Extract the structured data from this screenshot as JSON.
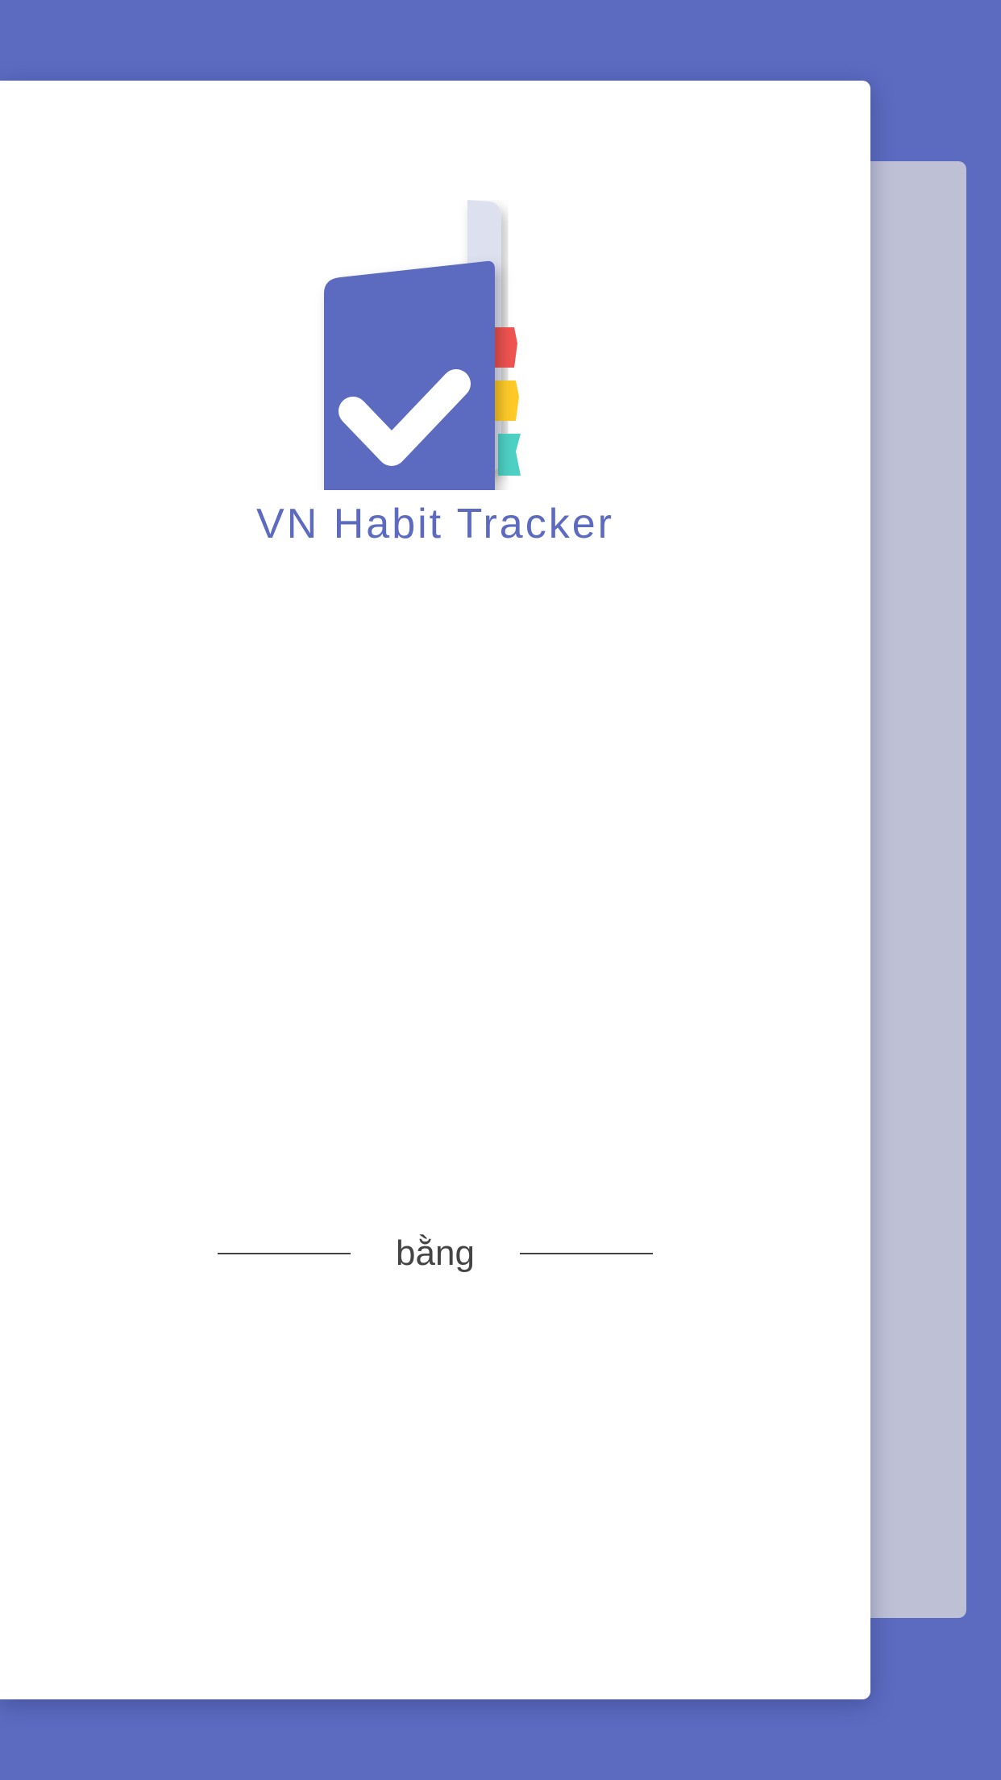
{
  "app": {
    "title": "VN Habit Tracker",
    "logo_icon": "habit-notebook-checkmark-icon"
  },
  "divider": {
    "text": "bằng"
  },
  "colors": {
    "brand": "#5c6bc0",
    "back_card": "#bec1d6",
    "card": "#ffffff",
    "tab_red": "#ef5350",
    "tab_yellow": "#ffca28",
    "tab_teal": "#4dd0c4",
    "divider": "#444444"
  }
}
